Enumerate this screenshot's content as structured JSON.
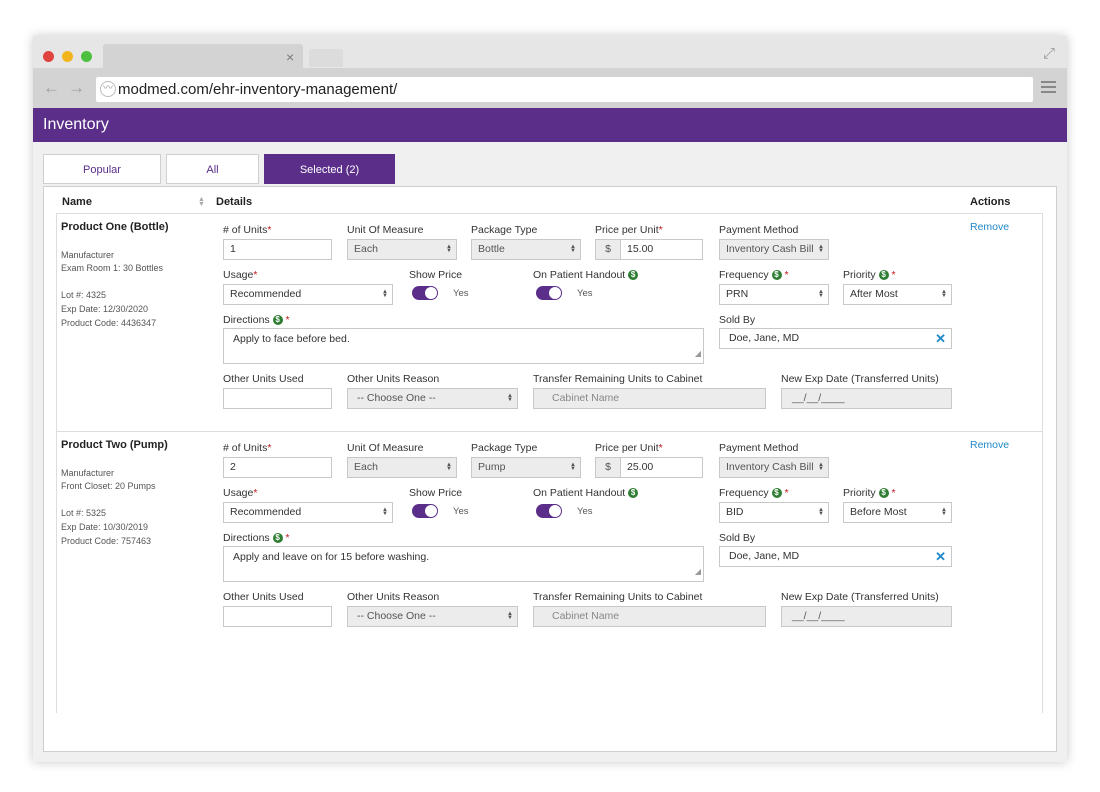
{
  "browser": {
    "url": "modmed.com/ehr-inventory-management/",
    "tab_close": "×",
    "back": "←",
    "forward": "→"
  },
  "app": {
    "title": "Inventory",
    "tabs": [
      "Popular",
      "All",
      "Selected (2)"
    ],
    "active_tab": "Selected (2)"
  },
  "table": {
    "headers": {
      "name": "Name",
      "details": "Details",
      "actions": "Actions"
    }
  },
  "labels": {
    "units": "# of Units",
    "uom": "Unit Of Measure",
    "package": "Package Type",
    "price": "Price per Unit",
    "payment": "Payment Method",
    "usage": "Usage",
    "show_price": "Show Price",
    "handout": "On Patient Handout",
    "frequency": "Frequency",
    "priority": "Priority",
    "directions": "Directions",
    "sold_by": "Sold By",
    "other_units": "Other Units Used",
    "other_reason": "Other Units Reason",
    "transfer": "Transfer Remaining Units to Cabinet",
    "new_exp": "New Exp Date (Transferred Units)",
    "remove": "Remove",
    "yes": "Yes",
    "required": "*",
    "currency": "$",
    "money_icon": "$"
  },
  "products": [
    {
      "name": "Product One (Bottle)",
      "manufacturer": "Manufacturer",
      "location": "Exam Room 1: 30 Bottles",
      "lot": "Lot #: 4325",
      "exp": "Exp Date: 12/30/2020",
      "code": "Product Code: 4436347",
      "units": "1",
      "uom": "Each",
      "package": "Bottle",
      "price": "15.00",
      "payment": "Inventory Cash Bill",
      "usage": "Recommended",
      "show_price": true,
      "on_handout": true,
      "frequency": "PRN",
      "priority": "After Most",
      "directions": "Apply to face before bed.",
      "sold_by": "Doe, Jane, MD",
      "other_units": "",
      "other_reason": "-- Choose One --",
      "cabinet_placeholder": "Cabinet Name",
      "new_exp_placeholder": "__/__/____"
    },
    {
      "name": "Product Two (Pump)",
      "manufacturer": "Manufacturer",
      "location": "Front Closet: 20 Pumps",
      "lot": "Lot #: 5325",
      "exp": "Exp Date: 10/30/2019",
      "code": "Product Code: 757463",
      "units": "2",
      "uom": "Each",
      "package": "Pump",
      "price": "25.00",
      "payment": "Inventory Cash Bill",
      "usage": "Recommended",
      "show_price": true,
      "on_handout": true,
      "frequency": "BID",
      "priority": "Before Most",
      "directions": "Apply and leave on for 15 before washing.",
      "sold_by": "Doe, Jane, MD",
      "other_units": "",
      "other_reason": "-- Choose One --",
      "cabinet_placeholder": "Cabinet Name",
      "new_exp_placeholder": "__/__/____"
    }
  ],
  "colors": {
    "brand": "#5a2e89",
    "link": "#1e88c8",
    "required": "#c0161b",
    "money": "#2e7d32"
  }
}
